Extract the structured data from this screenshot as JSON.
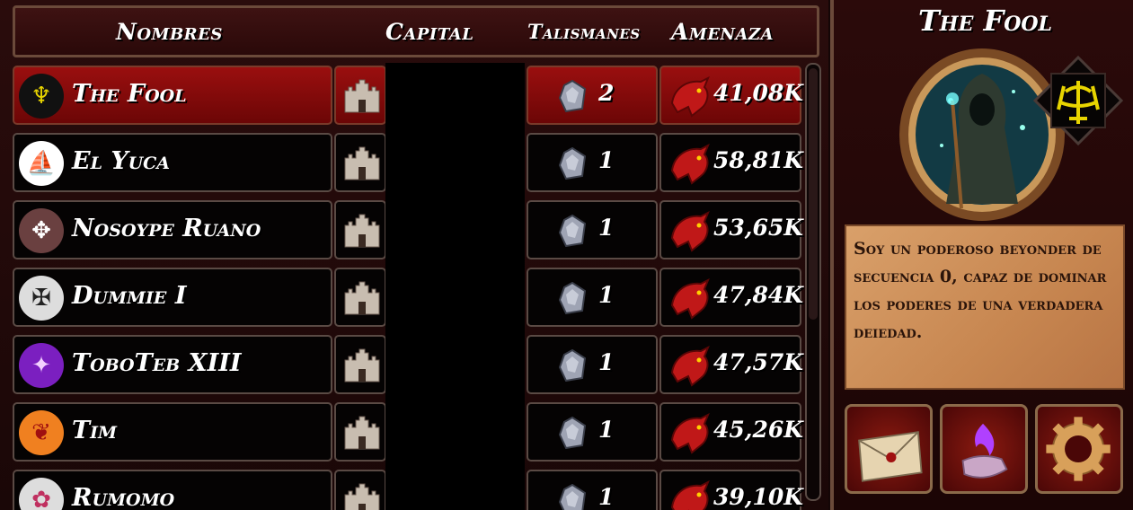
{
  "header": {
    "names": "Nombres",
    "capital": "Capital",
    "talismans": "Talismanes",
    "threat": "Amenaza"
  },
  "players": [
    {
      "name": "The Fool",
      "talismans": "2",
      "threat": "41,08K",
      "emblem": "yellow-crest-icon",
      "selected": true
    },
    {
      "name": "El Yuca",
      "talismans": "1",
      "threat": "58,81K",
      "emblem": "blue-ship-cross-icon",
      "selected": false
    },
    {
      "name": "Nosoype Ruano",
      "talismans": "1",
      "threat": "53,65K",
      "emblem": "griffin-icon",
      "selected": false
    },
    {
      "name": "Dummie I",
      "talismans": "1",
      "threat": "47,84K",
      "emblem": "black-eagle-shield-icon",
      "selected": false
    },
    {
      "name": "ToboTeb XIII",
      "talismans": "1",
      "threat": "47,57K",
      "emblem": "purple-dragon-shield-icon",
      "selected": false
    },
    {
      "name": "Tim",
      "talismans": "1",
      "threat": "45,26K",
      "emblem": "orange-dragon-shield-icon",
      "selected": false
    },
    {
      "name": "Rumomo",
      "talismans": "1",
      "threat": "39,10K",
      "emblem": "pink-shield-icon",
      "selected": false
    }
  ],
  "panel": {
    "title": "The Fool",
    "description": "Soy un poderoso beyonder de secuencia 0, capaz de dominar los poderes de una verdadera deiedad.",
    "buttons": [
      "mail-icon",
      "purple-flame-hand-icon",
      "gear-icon"
    ]
  },
  "colors": {
    "selected_row": "#8b0b0b",
    "parchment": "#d09058",
    "frame": "#6b4a3a"
  }
}
